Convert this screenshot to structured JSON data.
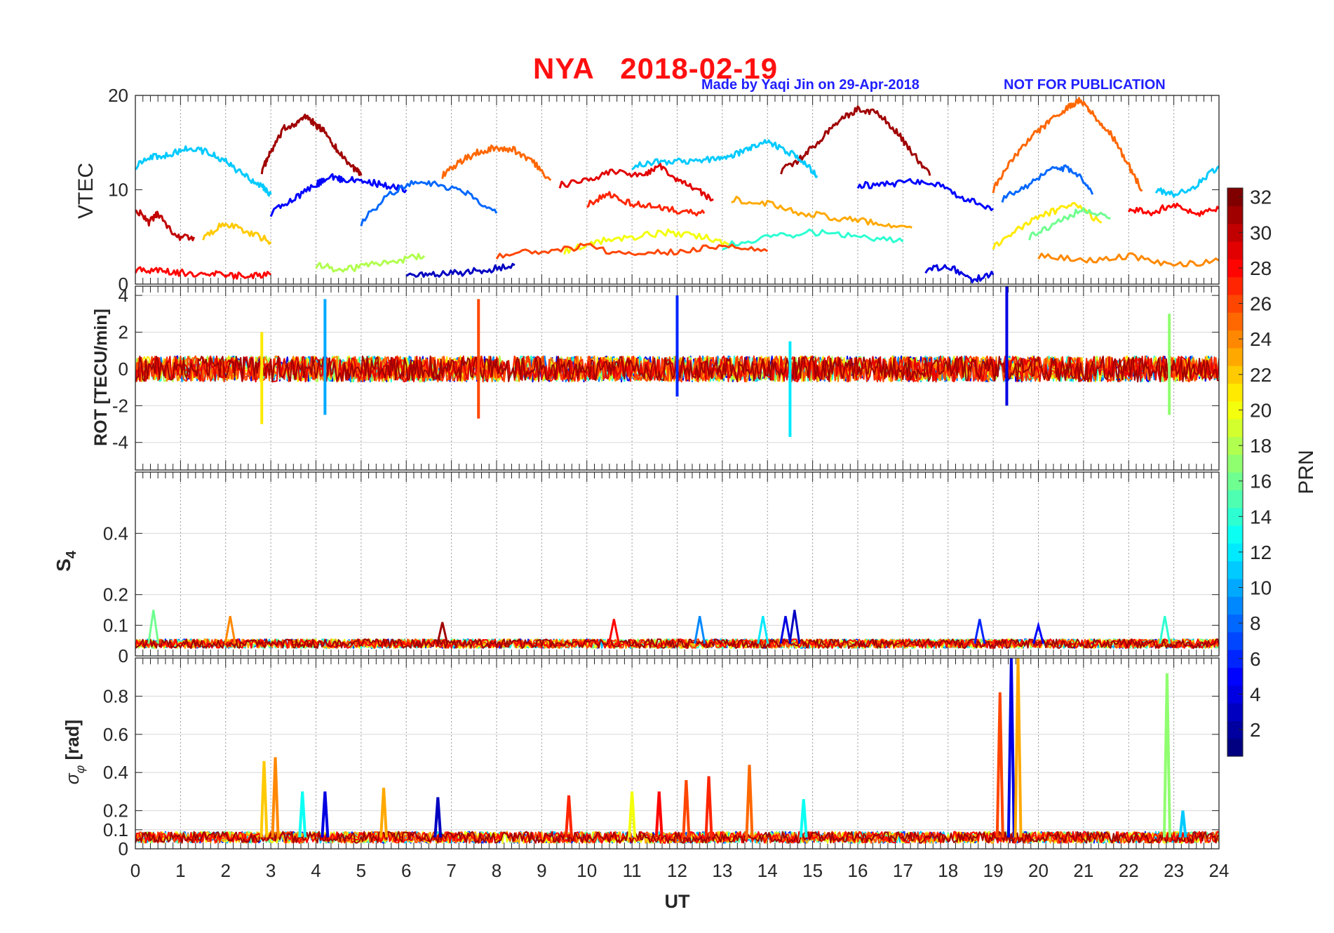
{
  "figure": {
    "title": "NYA   2018-02-19",
    "credit": "Made by Yaqi Jin on 29-Apr-2018",
    "notice": "NOT FOR PUBLICATION"
  },
  "chart_data": [
    {
      "type": "line",
      "panel": "VTEC",
      "ylabel": "VTEC",
      "ylim": [
        0,
        20
      ],
      "yticks": [
        "0",
        "10",
        "20"
      ],
      "xlim": [
        0,
        24
      ],
      "grid": "vertical dotted",
      "series_note_colors": "color by PRN (jet colormap)",
      "series": [
        {
          "prn": 31,
          "x": [
            2.8,
            3.0,
            3.3,
            3.6,
            3.8,
            4.0,
            4.2,
            4.5,
            4.8,
            5.0
          ],
          "y": [
            12,
            14,
            16.5,
            17.2,
            17.8,
            16.8,
            16.2,
            14,
            12.5,
            11.5
          ]
        },
        {
          "prn": 31,
          "x": [
            14.3,
            14.8,
            15.2,
            15.6,
            16.0,
            16.4,
            16.8,
            17.2,
            17.6
          ],
          "y": [
            12,
            13.5,
            15.5,
            17.5,
            18.5,
            18.3,
            16.5,
            14,
            11.5
          ]
        },
        {
          "prn": 25,
          "x": [
            19.0,
            19.4,
            19.8,
            20.2,
            20.6,
            20.9,
            21.2,
            21.6,
            22.0,
            22.3
          ],
          "y": [
            10,
            13,
            15.5,
            17,
            18.5,
            19.5,
            18,
            16,
            12.5,
            10
          ]
        },
        {
          "prn": 25,
          "x": [
            6.8,
            7.2,
            7.6,
            8.0,
            8.4,
            8.8,
            9.2
          ],
          "y": [
            11.5,
            13,
            14,
            14.5,
            14.2,
            13,
            11
          ]
        },
        {
          "prn": 11,
          "x": [
            0,
            0.4,
            0.8,
            1.2,
            1.6,
            2.0,
            2.4,
            2.8,
            3.0
          ],
          "y": [
            12.5,
            13.5,
            13.8,
            14.5,
            14,
            13,
            11.5,
            10.5,
            9.5
          ]
        },
        {
          "prn": 11,
          "x": [
            11.0,
            11.6,
            12.2,
            12.8,
            13.2,
            13.6,
            14.0,
            14.4,
            14.8,
            15.1
          ],
          "y": [
            12.5,
            13,
            13,
            13.2,
            13.5,
            14.5,
            15,
            14.2,
            13,
            11.5
          ]
        },
        {
          "prn": 11,
          "x": [
            22.6,
            23.0,
            23.5,
            24.0
          ],
          "y": [
            10,
            9.5,
            10.5,
            12.5
          ]
        },
        {
          "prn": 5,
          "x": [
            3.0,
            3.5,
            4.0,
            4.3,
            4.6,
            5.0,
            5.5,
            6.0
          ],
          "y": [
            7.5,
            9,
            10.5,
            11.5,
            11,
            11,
            10.5,
            10
          ]
        },
        {
          "prn": 5,
          "x": [
            16.0,
            16.6,
            17.2,
            17.8,
            18.4,
            19.0
          ],
          "y": [
            10.5,
            10.5,
            11,
            10.5,
            9,
            8
          ]
        },
        {
          "prn": 8,
          "x": [
            5.0,
            5.6,
            6.2,
            6.8,
            7.4,
            8.0
          ],
          "y": [
            6.5,
            9.5,
            11,
            10.5,
            9.5,
            7.5
          ]
        },
        {
          "prn": 8,
          "x": [
            19.2,
            19.8,
            20.4,
            20.8,
            21.2
          ],
          "y": [
            9,
            10.5,
            12.5,
            12,
            9.5
          ]
        },
        {
          "prn": 29,
          "x": [
            9.4,
            10.0,
            10.6,
            11.2,
            11.6,
            12.0,
            12.4,
            12.8
          ],
          "y": [
            10.5,
            11,
            12,
            11.5,
            12.5,
            11,
            10,
            9
          ]
        },
        {
          "prn": 27,
          "x": [
            10.0,
            10.5,
            11.0,
            11.5,
            12.0,
            12.6
          ],
          "y": [
            8.5,
            9.5,
            8.5,
            8.2,
            7.8,
            7.5
          ]
        },
        {
          "prn": 23,
          "x": [
            13.2,
            14.0,
            14.8,
            15.6,
            16.4,
            17.2
          ],
          "y": [
            9,
            8.5,
            7.5,
            7,
            6.5,
            6
          ]
        },
        {
          "prn": 30,
          "x": [
            0,
            0.3,
            0.5,
            0.9,
            1.3
          ],
          "y": [
            8,
            6.5,
            7.5,
            5,
            5
          ]
        },
        {
          "prn": 28,
          "x": [
            22.0,
            22.5,
            23.0,
            23.5,
            24.0
          ],
          "y": [
            8,
            7.5,
            8.5,
            7.5,
            8
          ]
        },
        {
          "prn": 22,
          "x": [
            1.5,
            2.0,
            2.5,
            3.0
          ],
          "y": [
            5,
            6.5,
            5.5,
            4.5
          ]
        },
        {
          "prn": 21,
          "x": [
            19.0,
            19.6,
            20.2,
            20.8,
            21.4
          ],
          "y": [
            4,
            6,
            7.5,
            8.5,
            6.5
          ]
        },
        {
          "prn": 16,
          "x": [
            19.8,
            20.4,
            21.0,
            21.6
          ],
          "y": [
            5,
            6.5,
            8,
            7
          ]
        },
        {
          "prn": 20,
          "x": [
            9.5,
            10.2,
            11.0,
            11.8,
            12.6,
            13.3
          ],
          "y": [
            3.5,
            4.5,
            5,
            5.5,
            5,
            4
          ]
        },
        {
          "prn": 14,
          "x": [
            13.0,
            14.0,
            15.0,
            16.0,
            17.0
          ],
          "y": [
            4,
            5,
            5.5,
            5,
            4.5
          ]
        },
        {
          "prn": 3,
          "x": [
            6.0,
            6.6,
            7.2,
            7.8,
            8.4
          ],
          "y": [
            1.2,
            1,
            1.2,
            1.5,
            2
          ]
        },
        {
          "prn": 4,
          "x": [
            17.5,
            18.0,
            18.5,
            19.0
          ],
          "y": [
            1.5,
            2,
            0.5,
            1
          ]
        },
        {
          "prn": 28,
          "x": [
            0,
            0.5,
            1.0,
            1.5,
            2.0,
            2.5,
            3.0
          ],
          "y": [
            1.5,
            1.5,
            1.2,
            1.1,
            1,
            0.8,
            1
          ]
        },
        {
          "prn": 18,
          "x": [
            4.0,
            4.6,
            5.2,
            5.8,
            6.4
          ],
          "y": [
            2,
            1.5,
            2,
            2.5,
            3
          ]
        },
        {
          "prn": 26,
          "x": [
            8.0,
            9.0,
            10.0,
            11.0,
            12.0,
            13.0,
            14.0
          ],
          "y": [
            3,
            3.5,
            4,
            3,
            3.5,
            4,
            3.5
          ]
        },
        {
          "prn": 24,
          "x": [
            20.0,
            21.0,
            22.0,
            23.0,
            24.0
          ],
          "y": [
            3,
            2.5,
            3,
            2,
            2.5
          ]
        }
      ]
    },
    {
      "type": "line",
      "panel": "ROT",
      "ylabel": "ROT [TECU/min]",
      "ylim": [
        -5.5,
        4.5
      ],
      "yticks": [
        "-4",
        "-2",
        "0",
        "2",
        "4"
      ],
      "xlim": [
        0,
        24
      ],
      "grid": "both",
      "spikes": [
        {
          "prn": 4,
          "x": 19.3,
          "ymax": 4.5,
          "ymin": -2.0
        },
        {
          "prn": 6,
          "x": 12.0,
          "ymax": 4.0,
          "ymin": -1.5
        },
        {
          "prn": 10,
          "x": 4.2,
          "ymax": 3.8,
          "ymin": -2.5
        },
        {
          "prn": 26,
          "x": 7.6,
          "ymax": 3.8,
          "ymin": -2.7
        },
        {
          "prn": 21,
          "x": 2.8,
          "ymax": 2.0,
          "ymin": -3.0
        },
        {
          "prn": 12,
          "x": 14.5,
          "ymax": 1.5,
          "ymin": -3.7
        },
        {
          "prn": 17,
          "x": 22.9,
          "ymax": 3.0,
          "ymin": -2.5
        }
      ]
    },
    {
      "type": "line",
      "panel": "S4",
      "ylabel": "S4",
      "ylim": [
        0,
        0.6
      ],
      "yticks": [
        "0",
        "0.1",
        "0.2",
        "0.4"
      ],
      "xlim": [
        0,
        24
      ],
      "grid": "both",
      "baseline": 0.04,
      "spikes": [
        {
          "prn": 16,
          "x": 0.4,
          "y": 0.15
        },
        {
          "prn": 24,
          "x": 2.1,
          "y": 0.13
        },
        {
          "prn": 31,
          "x": 6.8,
          "y": 0.11
        },
        {
          "prn": 28,
          "x": 10.6,
          "y": 0.12
        },
        {
          "prn": 9,
          "x": 12.5,
          "y": 0.13
        },
        {
          "prn": 12,
          "x": 13.9,
          "y": 0.13
        },
        {
          "prn": 4,
          "x": 14.4,
          "y": 0.13
        },
        {
          "prn": 3,
          "x": 14.6,
          "y": 0.15
        },
        {
          "prn": 6,
          "x": 18.7,
          "y": 0.12
        },
        {
          "prn": 5,
          "x": 20.0,
          "y": 0.1
        },
        {
          "prn": 14,
          "x": 22.8,
          "y": 0.13
        }
      ]
    },
    {
      "type": "line",
      "panel": "sigma_phi",
      "ylabel": "σφ [rad]",
      "ylim": [
        0,
        1.0
      ],
      "yticks": [
        "0",
        "0.1",
        "0.2",
        "0.4",
        "0.6",
        "0.8"
      ],
      "xlim": [
        0,
        24
      ],
      "xticks": [
        "0",
        "1",
        "2",
        "3",
        "4",
        "5",
        "6",
        "7",
        "8",
        "9",
        "10",
        "11",
        "12",
        "13",
        "14",
        "15",
        "16",
        "17",
        "18",
        "19",
        "20",
        "21",
        "22",
        "23",
        "24"
      ],
      "xlabel": "UT",
      "grid": "both",
      "baseline": 0.06,
      "spikes": [
        {
          "prn": 22,
          "x": 2.85,
          "y": 0.46
        },
        {
          "prn": 24,
          "x": 3.1,
          "y": 0.48
        },
        {
          "prn": 13,
          "x": 3.7,
          "y": 0.3
        },
        {
          "prn": 4,
          "x": 4.2,
          "y": 0.3
        },
        {
          "prn": 23,
          "x": 5.5,
          "y": 0.32
        },
        {
          "prn": 3,
          "x": 6.7,
          "y": 0.27
        },
        {
          "prn": 27,
          "x": 9.6,
          "y": 0.28
        },
        {
          "prn": 20,
          "x": 11.0,
          "y": 0.3
        },
        {
          "prn": 28,
          "x": 11.6,
          "y": 0.3
        },
        {
          "prn": 26,
          "x": 12.2,
          "y": 0.36
        },
        {
          "prn": 27,
          "x": 12.7,
          "y": 0.38
        },
        {
          "prn": 25,
          "x": 13.6,
          "y": 0.44
        },
        {
          "prn": 13,
          "x": 14.8,
          "y": 0.26
        },
        {
          "prn": 26,
          "x": 19.15,
          "y": 0.82
        },
        {
          "prn": 4,
          "x": 19.4,
          "y": 1.0
        },
        {
          "prn": 23,
          "x": 19.55,
          "y": 1.0
        },
        {
          "prn": 17,
          "x": 22.85,
          "y": 0.92
        },
        {
          "prn": 11,
          "x": 23.2,
          "y": 0.2
        }
      ]
    },
    {
      "type": "heatmap",
      "panel": "colorbar",
      "label": "PRN",
      "range": [
        1,
        32
      ],
      "ticks": [
        "2",
        "4",
        "6",
        "8",
        "10",
        "12",
        "14",
        "16",
        "18",
        "20",
        "22",
        "24",
        "26",
        "28",
        "30",
        "32"
      ]
    }
  ]
}
